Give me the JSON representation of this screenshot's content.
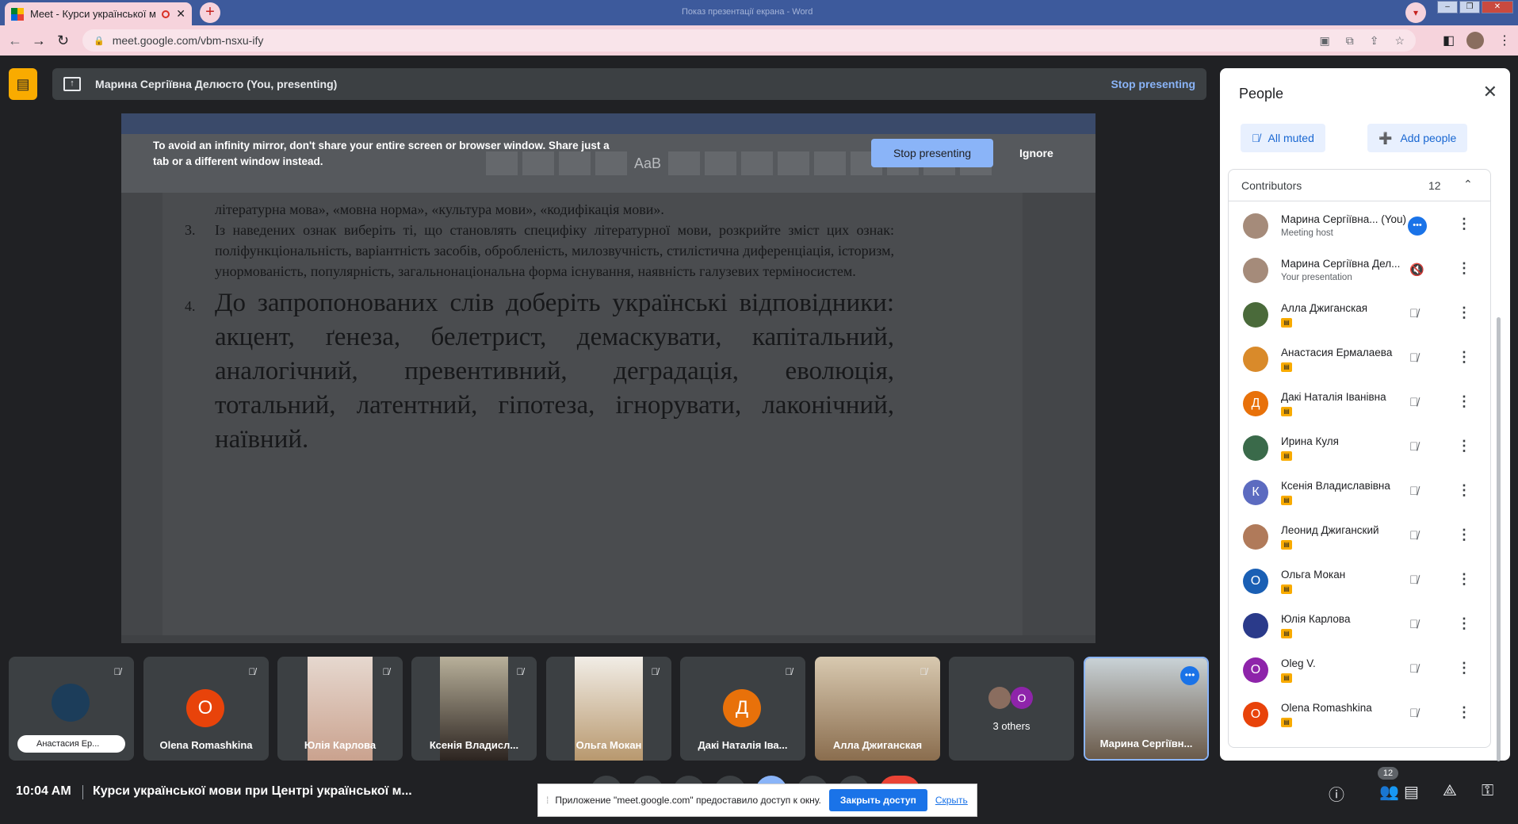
{
  "browser": {
    "tab_title": "Meet - Курси української м",
    "tab_close": "✕",
    "new_tab": "+",
    "center_title": "Показ презентації екрана - Word",
    "url": "meet.google.com/vbm-nsxu-ify",
    "window_buttons": [
      "–",
      "❐",
      "✕"
    ]
  },
  "presenting_bar": {
    "name": "Марина Сергіївна Делюсто (You, presenting)",
    "stop_label": "Stop presenting"
  },
  "warning": {
    "text": "To avoid an infinity mirror, don't share your entire screen or browser window. Share just a tab or a different window instead.",
    "stop_label": "Stop presenting",
    "ignore_label": "Ignore"
  },
  "ribbon": {
    "style_sample": "AaB"
  },
  "document": {
    "line_top": "літературна мова», «мовна норма», «культура мови», «кодифікація мови».",
    "item3_num": "3.",
    "item3_text": "Із наведених ознак виберіть ті, що становлять специфіку літературної мови, розкрийте зміст цих ознак: поліфункціональність, варіантність засобів, обробленість, милозвучність, стилістична диференціація, історизм, унормованість, популярність, загальнонаціональна форма існування, наявність галузевих терміносистем.",
    "item4_num": "4.",
    "item4_text": "До запропонованих слів доберіть українські відповідники: акцент, ґенеза, белетрист, демаскувати, капітальний, аналогічний, превентивний, деградація, еволюція, тотальний, латентний, гіпотеза, ігнорувати, лаконічний, наївний."
  },
  "tiles": [
    {
      "name": "Анастасия Ер...",
      "type": "pill"
    },
    {
      "name": "Olena Romashkina",
      "initial": "O",
      "color": "#e8430a"
    },
    {
      "name": "Юлія Карлова",
      "type": "video"
    },
    {
      "name": "Ксенія Владисл...",
      "type": "video"
    },
    {
      "name": "Ольга Мокан",
      "type": "video"
    },
    {
      "name": "Дакі Наталія Іва...",
      "initial": "Д",
      "color": "#e8710a"
    },
    {
      "name": "Алла Джиганская",
      "type": "video"
    },
    {
      "name": "3 others",
      "initial": "O"
    },
    {
      "name": "Марина Сергіївн...",
      "type": "video"
    }
  ],
  "bottom": {
    "time": "10:04 AM",
    "meeting_title": "Курси української мови при Центрі української м...",
    "people_count": "12"
  },
  "infobar": {
    "text": "Приложение \"meet.google.com\" предоставило доступ к окну.",
    "close_access": "Закрыть доступ",
    "hide": "Скрыть"
  },
  "people_panel": {
    "title": "People",
    "all_muted": "All muted",
    "add_people": "Add people",
    "contributors_label": "Contributors",
    "contributors_count": "12",
    "people": [
      {
        "name": "Марина Сергіївна... (You)",
        "sub": "Meeting host",
        "color": "#a58b7a",
        "initial": ""
      },
      {
        "name": "Марина Сергіївна Дел...",
        "sub": "Your presentation",
        "color": "#a58b7a",
        "initial": ""
      },
      {
        "name": "Алла Джиганская",
        "color": "#4a6a3a",
        "initial": ""
      },
      {
        "name": "Анастасия Ермалаева",
        "color": "#d98a2a",
        "initial": ""
      },
      {
        "name": "Дакі Наталія Іванівна",
        "color": "#e8710a",
        "initial": "Д"
      },
      {
        "name": "Ирина Куля",
        "color": "#3a6a4a",
        "initial": ""
      },
      {
        "name": "Ксенія Владиславівна",
        "color": "#5c6bc0",
        "initial": "К"
      },
      {
        "name": "Леонид Джиганский",
        "color": "#b07a5a",
        "initial": ""
      },
      {
        "name": "Ольга Мокан",
        "color": "#1a5fb4",
        "initial": "О"
      },
      {
        "name": "Юлія Карлова",
        "color": "#2a3a8a",
        "initial": ""
      },
      {
        "name": "Oleg V.",
        "color": "#8e24aa",
        "initial": "O"
      },
      {
        "name": "Olena Romashkina",
        "color": "#e8430a",
        "initial": "O"
      }
    ]
  }
}
